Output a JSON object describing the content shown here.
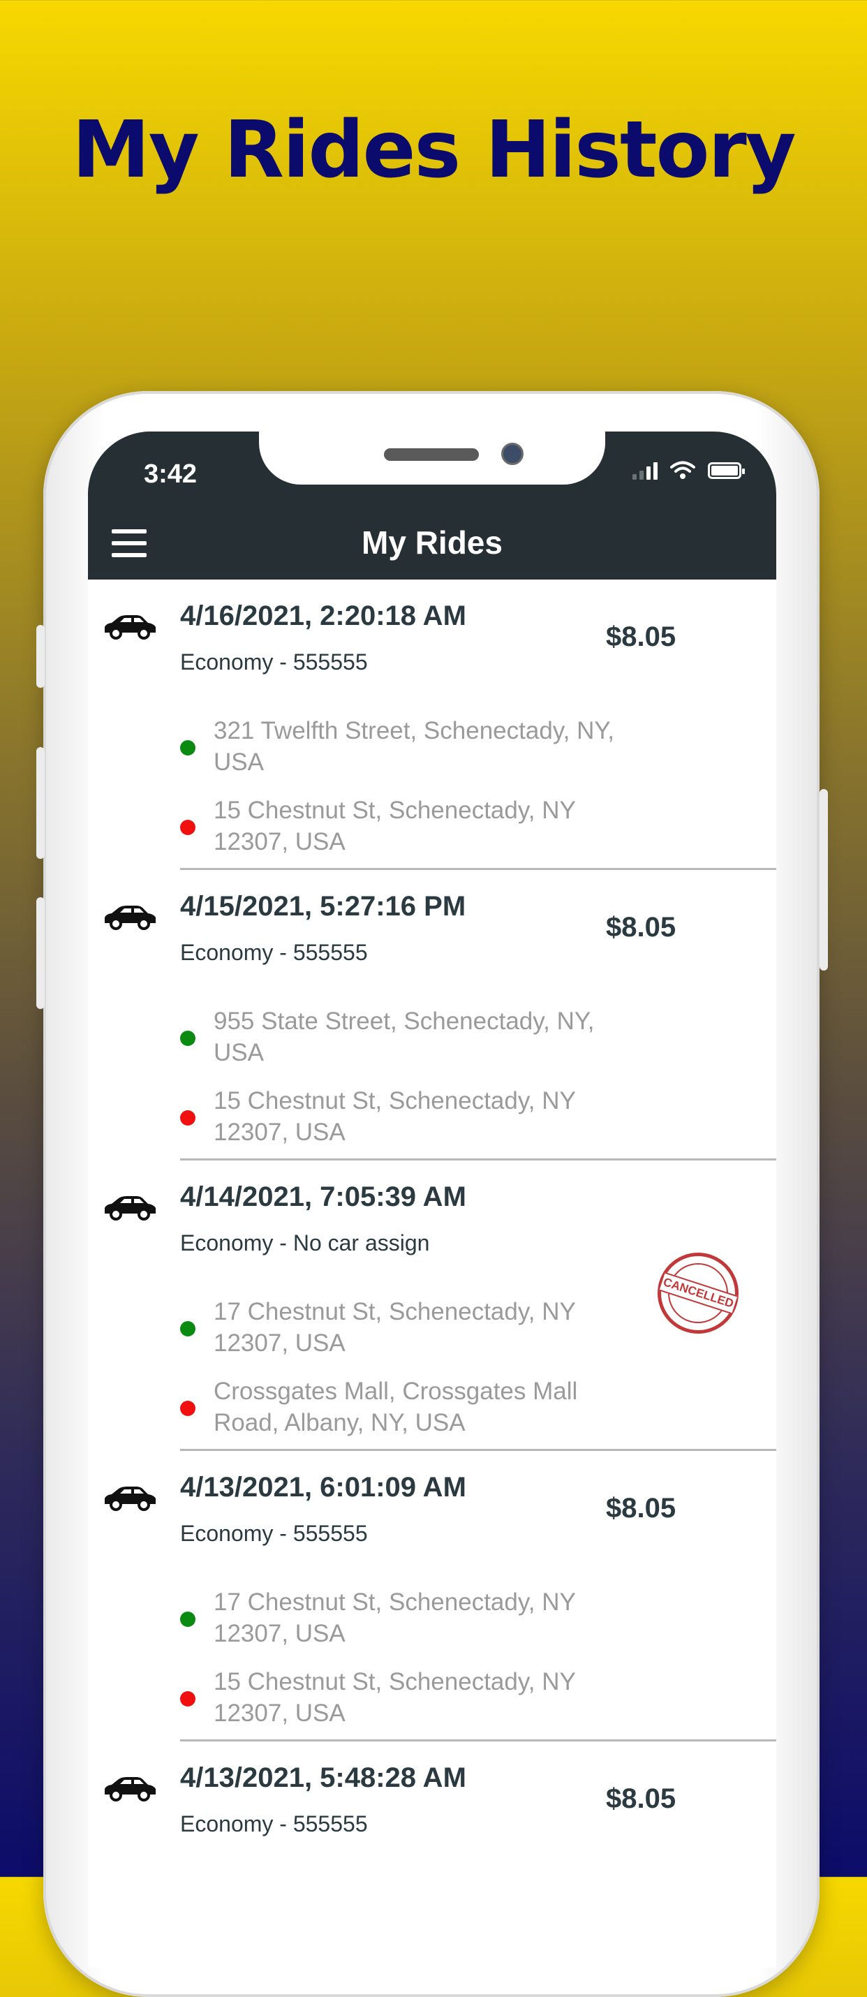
{
  "headline": "My Rides History",
  "status_bar": {
    "time": "3:42"
  },
  "app_bar": {
    "title": "My Rides"
  },
  "icons": {
    "menu": "hamburger-menu-icon",
    "ride": "car-icon",
    "pickup": "green-dot-icon",
    "dropoff": "red-dot-icon",
    "cancelled": "cancelled-stamp-icon"
  },
  "colors": {
    "appbar": "#252f34",
    "pickup": "#0b8a12",
    "dropoff": "#f01010",
    "headline": "#0b0b6e"
  },
  "rides": [
    {
      "datetime": "4/16/2021, 2:20:18 AM",
      "category": "Economy - 555555",
      "fare": "$8.05",
      "pickup": "321 Twelfth Street, Schenectady, NY, USA",
      "dropoff": "15 Chestnut St, Schenectady, NY 12307, USA"
    },
    {
      "datetime": "4/15/2021, 5:27:16 PM",
      "category": "Economy - 555555",
      "fare": "$8.05",
      "pickup": "955 State Street, Schenectady, NY, USA",
      "dropoff": "15 Chestnut St, Schenectady, NY 12307, USA"
    },
    {
      "datetime": "4/14/2021, 7:05:39 AM",
      "category": "Economy - No car assign",
      "status": "CANCELLED",
      "pickup": "17 Chestnut St, Schenectady, NY 12307, USA",
      "dropoff": "Crossgates Mall, Crossgates Mall Road, Albany, NY, USA"
    },
    {
      "datetime": "4/13/2021, 6:01:09 AM",
      "category": "Economy - 555555",
      "fare": "$8.05",
      "pickup": "17 Chestnut St, Schenectady, NY 12307, USA",
      "dropoff": "15 Chestnut St, Schenectady, NY 12307, USA"
    },
    {
      "datetime": "4/13/2021, 5:48:28 AM",
      "category": "Economy - 555555",
      "fare": "$8.05"
    }
  ]
}
